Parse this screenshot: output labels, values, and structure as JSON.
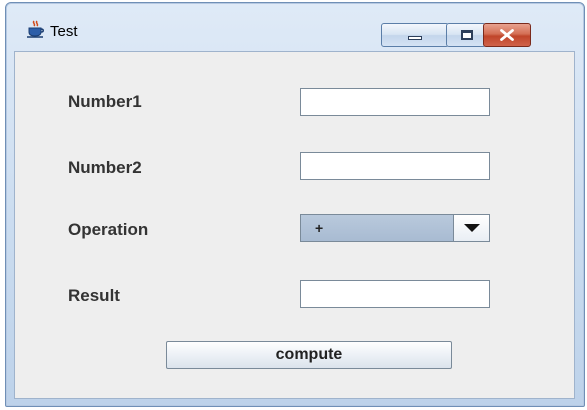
{
  "window": {
    "title": "Test",
    "icon": "java-cup-icon"
  },
  "form": {
    "number1": {
      "label": "Number1",
      "value": ""
    },
    "number2": {
      "label": "Number2",
      "value": ""
    },
    "operation": {
      "label": "Operation",
      "selected": "+"
    },
    "result": {
      "label": "Result",
      "value": ""
    },
    "compute_label": "compute"
  },
  "colors": {
    "close_button": "#c0452a",
    "client_background": "#eeeeee",
    "combo_background": "#a8bbd2"
  }
}
